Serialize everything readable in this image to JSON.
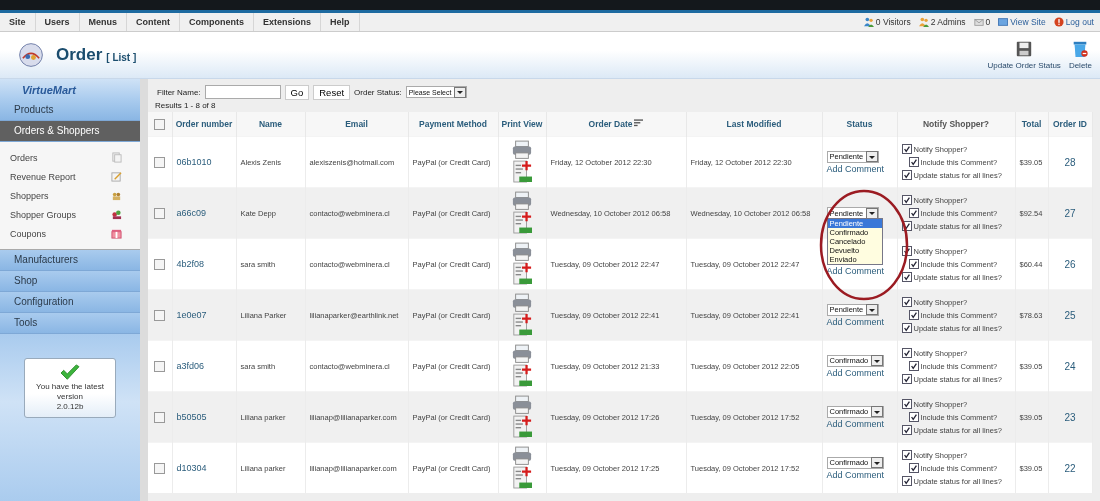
{
  "menu": [
    "Site",
    "Users",
    "Menus",
    "Content",
    "Components",
    "Extensions",
    "Help"
  ],
  "status_links": [
    {
      "kind": "visitors",
      "label": "0 Visitors"
    },
    {
      "kind": "admins",
      "label": "2 Admins"
    },
    {
      "kind": "messages",
      "label": "0"
    },
    {
      "kind": "site",
      "label": "View Site"
    },
    {
      "kind": "logout",
      "label": "Log out"
    }
  ],
  "header": {
    "title": "Order",
    "subtitle": "[ List ]"
  },
  "toolbar": [
    {
      "kind": "save",
      "label": "Update Order Status"
    },
    {
      "kind": "delete",
      "label": "Delete"
    }
  ],
  "sidebar": {
    "brand": "VirtueMart",
    "sections": [
      {
        "label": "Products",
        "selected": false
      },
      {
        "label": "Orders & Shoppers",
        "selected": true,
        "children": [
          {
            "label": "Orders",
            "kind": "orders"
          },
          {
            "label": "Revenue Report",
            "kind": "report"
          },
          {
            "label": "Shoppers",
            "kind": "shoppers"
          },
          {
            "label": "Shopper Groups",
            "kind": "groups"
          },
          {
            "label": "Coupons",
            "kind": "coupons"
          }
        ]
      },
      {
        "label": "Manufacturers",
        "selected": false
      },
      {
        "label": "Shop",
        "selected": false
      },
      {
        "label": "Configuration",
        "selected": false
      },
      {
        "label": "Tools",
        "selected": false
      }
    ]
  },
  "version_notice": {
    "text": "You have the latest version",
    "version": "2.0.12b"
  },
  "filter": {
    "label": "Filter Name:",
    "go": "Go",
    "reset": "Reset",
    "status_label": "Order Status:",
    "status_value": "Please Select"
  },
  "results": "Results 1 - 8 of 8",
  "table": {
    "select_all_checked": false,
    "columns": [
      {
        "label": "Order number",
        "sorted": false
      },
      {
        "label": "Name",
        "sorted": false
      },
      {
        "label": "Email",
        "sorted": false
      },
      {
        "label": "Payment Method",
        "sorted": false
      },
      {
        "label": "Print View",
        "sorted": false
      },
      {
        "label": "Order Date",
        "sorted": true
      },
      {
        "label": "Last Modified",
        "sorted": false
      },
      {
        "label": "Status",
        "sorted": false
      },
      {
        "label": "Notify Shopper?",
        "sorted": false
      },
      {
        "label": "Total",
        "sorted": false
      },
      {
        "label": "Order ID",
        "sorted": false
      }
    ],
    "rows": [
      {
        "checked": false,
        "order_number": "06b1010",
        "name": "Alexis Zenis",
        "email": "alexiszenis@hotmail.com",
        "payment": "PayPal (or Credit Card)",
        "order_date": "Friday, 12 October 2012 22:30",
        "last_modified": "Friday, 12 October 2012 22:30",
        "status": "Pendiente",
        "comment_link": "Add Comment",
        "options": [
          {
            "kind": "notify",
            "label": "Notify Shopper?",
            "checked": true
          },
          {
            "kind": "include",
            "label": "Include this Comment?",
            "checked": true
          },
          {
            "kind": "update",
            "label": "Update status for all lines?",
            "checked": true
          }
        ],
        "total": "$39.05",
        "order_id": "28"
      },
      {
        "checked": false,
        "order_number": "a66c09",
        "name": "Kate Depp",
        "email": "contacto@webminera.cl",
        "payment": "PayPal (or Credit Card)",
        "order_date": "Wednesday, 10 October 2012 06:58",
        "last_modified": "Wednesday, 10 October 2012 06:58",
        "status": "Pendiente",
        "dropdown_open": true,
        "dropdown_options": [
          {
            "label": "Pendiente",
            "selected": true
          },
          {
            "label": "Confirmado",
            "selected": false
          },
          {
            "label": "Cancelado",
            "selected": false
          },
          {
            "label": "Devuelto",
            "selected": false
          },
          {
            "label": "Enviado",
            "selected": false
          }
        ],
        "options": [
          {
            "kind": "notify",
            "label": "Notify Shopper?",
            "checked": true
          },
          {
            "kind": "include",
            "label": "Include this Comment?",
            "checked": true
          },
          {
            "kind": "update",
            "label": "Update status for all lines?",
            "checked": true
          }
        ],
        "total": "$92.54",
        "order_id": "27"
      },
      {
        "checked": false,
        "order_number": "4b2f08",
        "name": "sara smith",
        "email": "contacto@webminera.cl",
        "payment": "PayPal (or Credit Card)",
        "order_date": "Tuesday, 09 October 2012 22:47",
        "last_modified": "Tuesday, 09 October 2012 22:47",
        "comment_link": "Add Comment",
        "options": [
          {
            "kind": "notify",
            "label": "Notify Shopper?",
            "checked": true
          },
          {
            "kind": "include",
            "label": "Include this Comment?",
            "checked": true
          },
          {
            "kind": "update",
            "label": "Update status for all lines?",
            "checked": true
          }
        ],
        "total": "$60.44",
        "order_id": "26"
      },
      {
        "checked": false,
        "order_number": "1e0e07",
        "name": "Liliana Parker",
        "email": "lilianaparker@earthlink.net",
        "payment": "PayPal (or Credit Card)",
        "order_date": "Tuesday, 09 October 2012 22:41",
        "last_modified": "Tuesday, 09 October 2012 22:41",
        "status": "Pendiente",
        "comment_link": "Add Comment",
        "options": [
          {
            "kind": "notify",
            "label": "Notify Shopper?",
            "checked": true
          },
          {
            "kind": "include",
            "label": "Include this Comment?",
            "checked": true
          },
          {
            "kind": "update",
            "label": "Update status for all lines?",
            "checked": true
          }
        ],
        "total": "$78.63",
        "order_id": "25"
      },
      {
        "checked": false,
        "order_number": "a3fd06",
        "name": "sara smith",
        "email": "contacto@webminera.cl",
        "payment": "PayPal (or Credit Card)",
        "order_date": "Tuesday, 09 October 2012 21:33",
        "last_modified": "Tuesday, 09 October 2012 22:05",
        "status": "Confirmado",
        "comment_link": "Add Comment",
        "options": [
          {
            "kind": "notify",
            "label": "Notify Shopper?",
            "checked": true
          },
          {
            "kind": "include",
            "label": "Include this Comment?",
            "checked": true
          },
          {
            "kind": "update",
            "label": "Update status for all lines?",
            "checked": true
          }
        ],
        "total": "$39.05",
        "order_id": "24"
      },
      {
        "checked": false,
        "order_number": "b50505",
        "name": "Liliana parker",
        "email": "lilianap@lilianaparker.com",
        "payment": "PayPal (or Credit Card)",
        "order_date": "Tuesday, 09 October 2012 17:26",
        "last_modified": "Tuesday, 09 October 2012 17:52",
        "status": "Confirmado",
        "comment_link": "Add Comment",
        "options": [
          {
            "kind": "notify",
            "label": "Notify Shopper?",
            "checked": true
          },
          {
            "kind": "include",
            "label": "Include this Comment?",
            "checked": true
          },
          {
            "kind": "update",
            "label": "Update status for all lines?",
            "checked": true
          }
        ],
        "total": "$39.05",
        "order_id": "23"
      },
      {
        "checked": false,
        "order_number": "d10304",
        "name": "Liliana parker",
        "email": "lilianap@lilianaparker.com",
        "payment": "PayPal (or Credit Card)",
        "order_date": "Tuesday, 09 October 2012 17:25",
        "last_modified": "Tuesday, 09 October 2012 17:52",
        "status": "Confirmado",
        "comment_link": "Add Comment",
        "options": [
          {
            "kind": "notify",
            "label": "Notify Shopper?",
            "checked": true
          },
          {
            "kind": "include",
            "label": "Include this Comment?",
            "checked": true
          },
          {
            "kind": "update",
            "label": "Update status for all lines?",
            "checked": true
          }
        ],
        "total": "$39.05",
        "order_id": "22"
      }
    ]
  }
}
